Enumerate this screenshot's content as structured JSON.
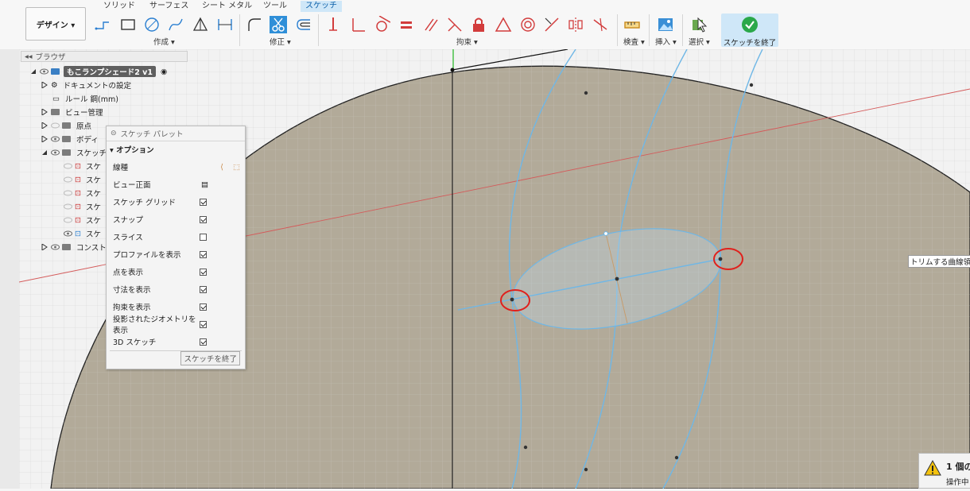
{
  "toolbar": {
    "design_label": "デザイン ▾",
    "tabs": [
      {
        "label": "ソリッド"
      },
      {
        "label": "サーフェス"
      },
      {
        "label": "シート メタル"
      },
      {
        "label": "ツール"
      },
      {
        "label": "スケッチ"
      }
    ],
    "groups": {
      "create": "作成 ▾",
      "modify": "修正 ▾",
      "constraints": "拘束 ▾",
      "inspect": "検査 ▾",
      "insert": "挿入 ▾",
      "select": "選択 ▾",
      "finish": "スケッチを終了 ▾"
    }
  },
  "browser": {
    "header": "ブラウザ",
    "items": [
      {
        "label": "もこランプシェード2 v1"
      },
      {
        "label": "ドキュメントの設定"
      },
      {
        "label": "ルール 鋼(mm)"
      },
      {
        "label": "ビュー管理"
      },
      {
        "label": "原点"
      },
      {
        "label": "ボディ"
      },
      {
        "label": "スケッチ"
      },
      {
        "label": "スケ"
      },
      {
        "label": "スケ"
      },
      {
        "label": "スケ"
      },
      {
        "label": "スケ"
      },
      {
        "label": "スケ"
      },
      {
        "label": "スケ"
      },
      {
        "label": "コンスト"
      }
    ]
  },
  "palette": {
    "title": "スケッチ パレット",
    "options_label": "オプション",
    "rows": [
      {
        "label": "線種"
      },
      {
        "label": "ビュー正面"
      },
      {
        "label": "スケッチ グリッド",
        "checked": true
      },
      {
        "label": "スナップ",
        "checked": true
      },
      {
        "label": "スライス",
        "checked": false
      },
      {
        "label": "プロファイルを表示",
        "checked": true
      },
      {
        "label": "点を表示",
        "checked": true
      },
      {
        "label": "寸法を表示",
        "checked": true
      },
      {
        "label": "拘束を表示",
        "checked": true
      },
      {
        "label": "投影されたジオメトリを表示",
        "checked": true
      },
      {
        "label": "3D スケッチ",
        "checked": true
      }
    ],
    "finish_label": "スケッチを終了"
  },
  "tooltip": "トリムする曲線領域",
  "warning": {
    "title": "1 個の",
    "subtitle": "操作中"
  },
  "colors": {
    "accent": "#0b5fa8",
    "active_tab": "#cfe7f8",
    "sketch_curve": "#6fb7e6",
    "shade": "#a09684",
    "red_axis": "#d45a5a",
    "green_axis": "#3fbf3f",
    "highlight_circle": "#e0201c"
  }
}
